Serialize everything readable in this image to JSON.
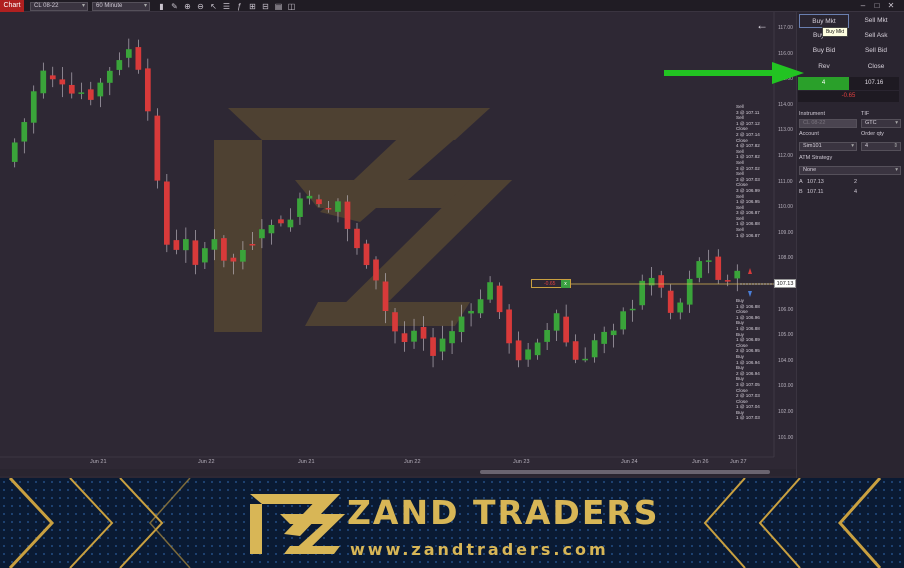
{
  "window": {
    "title": "Chart",
    "instrument_select": "CL 08-22",
    "interval_select": "60 Minute"
  },
  "chart": {
    "price_axis": [
      "117.00",
      "116.00",
      "115.00",
      "114.00",
      "113.00",
      "112.00",
      "111.00",
      "110.00",
      "109.00",
      "108.00",
      "107.00",
      "106.00",
      "105.00",
      "104.00",
      "103.00",
      "102.00",
      "101.00"
    ],
    "date_axis": [
      "Jun 21",
      "Jun 22",
      "Jun 21",
      "Jun 22",
      "Jun 23",
      "Jun 24",
      "Jun 26",
      "Jun 27"
    ],
    "current_price": "107.13",
    "order_line_value": "-0.65",
    "order_line_close": "x",
    "executions_top": [
      "Sell",
      "3 @ 107.11",
      "Sell",
      "1 @ 107.12",
      "Close",
      "2 @ 107.14",
      "Close",
      "4 @ 107.82",
      "Sell",
      "1 @ 107.82",
      "Sell",
      "3 @ 107.02",
      "Sell",
      "3 @ 107.03",
      "Close",
      "3 @ 106.99",
      "Sell",
      "1 @ 106.95",
      "Sell",
      "3 @ 106.87",
      "Sell",
      "1 @ 106.88",
      "Sell",
      "1 @ 106.87"
    ],
    "executions_bottom": [
      "Buy",
      "1 @ 106.88",
      "Close",
      "1 @ 106.96",
      "Buy",
      "1 @ 106.88",
      "Buy",
      "1 @ 106.89",
      "Close",
      "2 @ 106.95",
      "Buy",
      "1 @ 106.94",
      "Buy",
      "2 @ 106.94",
      "Buy",
      "3 @ 107.05",
      "Close",
      "2 @ 107.03",
      "Close",
      "1 @ 107.04",
      "Buy",
      "1 @ 107.03"
    ]
  },
  "order_panel": {
    "buy_mkt": "Buy Mkt",
    "sell_mkt": "Sell Mkt",
    "buy_ask": "Buy",
    "sell_ask": "Sell Ask",
    "buy_bid": "Buy Bid",
    "sell_bid": "Sell Bid",
    "rev": "Rev",
    "close": "Close",
    "tooltip": "Buy Mkt",
    "position_qty": "4",
    "position_price": "107.16",
    "unrealized_pnl": "-0.65",
    "instrument_label": "Instrument",
    "instrument_value": "CL 08-22",
    "tif_label": "TIF",
    "tif_value": "GTC",
    "account_label": "Account",
    "account_value": "Sim101",
    "order_qty_label": "Order qty",
    "order_qty_value": "4",
    "atm_label": "ATM Strategy",
    "atm_value": "None",
    "ask_row_label": "A",
    "ask_row_price": "107.13",
    "ask_row_size": "2",
    "bid_row_label": "B",
    "bid_row_price": "107.11",
    "bid_row_size": "4"
  },
  "banner": {
    "brand_name": "ZAND TRADERS",
    "url": "www.zandtraders.com"
  },
  "colors": {
    "up_candle": "#3aa43a",
    "down_candle": "#d83a3a",
    "chart_bg": "#2e2834",
    "brand_gold": "#d8b656",
    "banner_bg": "#0a1a33",
    "annotation_arrow": "#22c322"
  }
}
